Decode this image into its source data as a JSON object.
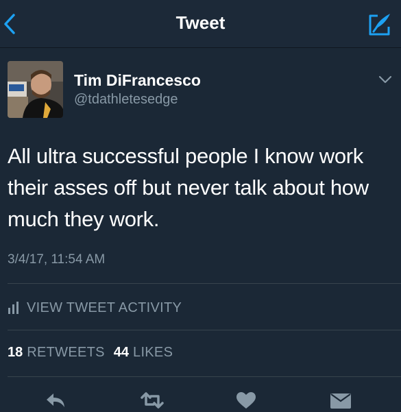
{
  "nav": {
    "title": "Tweet",
    "back_icon": "chevron-left-icon",
    "compose_icon": "compose-tweet-icon"
  },
  "author": {
    "name": "Tim DiFrancesco",
    "handle": "@tdathletesedge"
  },
  "tweet": {
    "text": "All ultra successful people I know work their asses off but never talk about how much they work.",
    "timestamp": "3/4/17, 11:54 AM"
  },
  "activity": {
    "label": "VIEW TWEET ACTIVITY",
    "icon": "bar-chart-icon"
  },
  "stats": {
    "retweets_count": "18",
    "retweets_label": "RETWEETS",
    "likes_count": "44",
    "likes_label": "LIKES"
  },
  "actions": [
    "reply-icon",
    "retweet-icon",
    "like-icon",
    "direct-message-icon"
  ],
  "colors": {
    "background": "#1b2836",
    "accent": "#1da1f2",
    "muted_text": "#8899a6",
    "divider": "#38444d"
  }
}
